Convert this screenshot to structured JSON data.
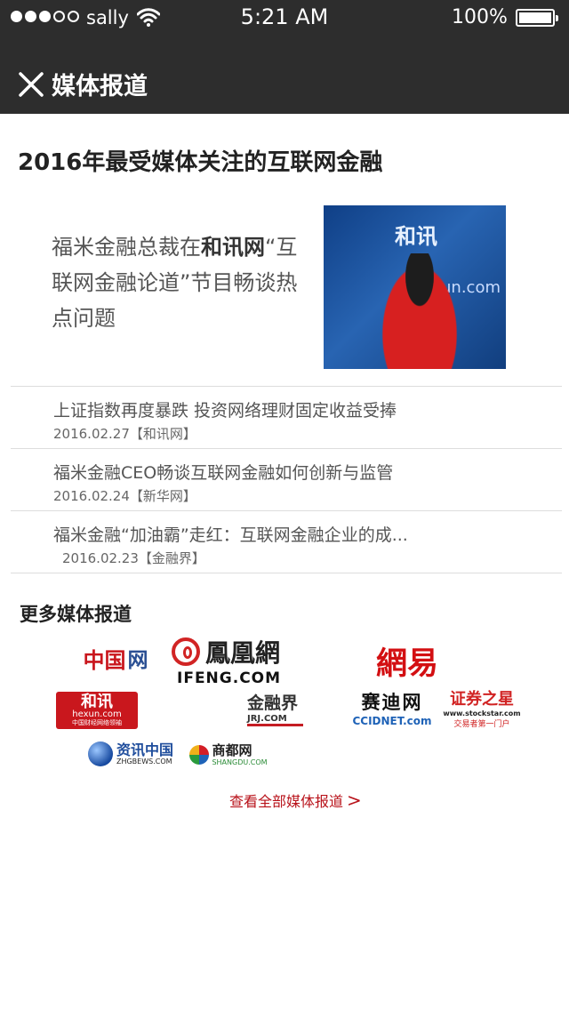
{
  "status_bar": {
    "carrier": "sally",
    "time": "5:21 AM",
    "battery": "100%"
  },
  "nav": {
    "title": "媒体报道"
  },
  "headline": "2016年最受媒体关注的互联网金融",
  "feature": {
    "text_before": "福米金融总裁在",
    "text_bold": "和讯网",
    "text_after": "“互联网金融论道”节目畅谈热点问题",
    "photo_logo": "和讯",
    "photo_url": "hexun.com"
  },
  "news": [
    {
      "title": "上证指数再度暴跌 投资网络理财固定收益受捧",
      "date": "2016.02.27",
      "source": "【和讯网】"
    },
    {
      "title": "福米金融CEO畅谈互联网金融如何创新与监管",
      "date": "2016.02.24",
      "source": "【新华网】"
    },
    {
      "title": "福米金融“加油霸”走红：互联网金融企业的成...",
      "date": "2016.02.23",
      "source": "【金融界】"
    }
  ],
  "more_title": "更多媒体报道",
  "logos": {
    "china_left": "中国",
    "china_right": "网",
    "ifeng_text": "鳳凰網",
    "ifeng_sub": "IFENG.COM",
    "netease": "網易",
    "hexun_main": "和讯",
    "hexun_url": "hexun.com",
    "hexun_sub": "中国财经网络领袖",
    "jrj_main": "金融界",
    "jrj_url": "JRJ.COM",
    "ccid_main": "赛迪网",
    "ccid_sub": "CCIDNET.com",
    "stockstar_main": "证券之星",
    "stockstar_url": "www.stockstar.com",
    "stockstar_sub": "交易者第一门户",
    "zhgbews_main": "资讯中国",
    "zhgbews_sub": "ZHGBEWS.COM",
    "shangdu_main": "商都网",
    "shangdu_sub": "SHANGDU.COM"
  },
  "view_all": "查看全部媒体报道",
  "icons": {
    "close": "close-icon",
    "wifi": "wifi-icon",
    "battery": "battery-icon",
    "arrow": "chevron-right-icon"
  },
  "colors": {
    "nav_bg": "#2d2d2d",
    "accent_red": "#b8121a"
  }
}
